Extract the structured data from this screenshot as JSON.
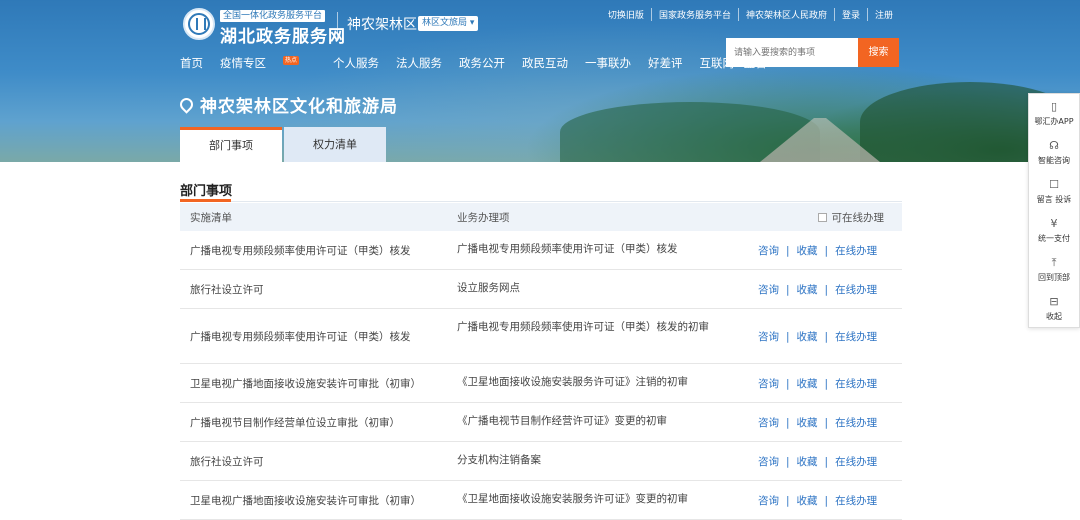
{
  "header": {
    "site_sub": "全国一体化政务服务平台",
    "site_name": "湖北政务服务网",
    "region": "神农架林区",
    "region_switch": "林区文旅局 ▾",
    "top_links": [
      "切换旧版",
      "国家政务服务平台",
      "神农架林区人民政府",
      "登录",
      "注册"
    ],
    "search_placeholder": "请输入要搜索的事项",
    "search_button": "搜索",
    "nav": [
      {
        "label": "首页"
      },
      {
        "label": "疫情专区",
        "badge": "热点"
      },
      {
        "label": "个人服务"
      },
      {
        "label": "法人服务"
      },
      {
        "label": "政务公开"
      },
      {
        "label": "政民互动"
      },
      {
        "label": "一事联办"
      },
      {
        "label": "好差评"
      },
      {
        "label": "互联网+监管"
      }
    ]
  },
  "department": {
    "title": "神农架林区文化和旅游局",
    "tabs": [
      "部门事项",
      "权力清单"
    ]
  },
  "section": {
    "title": "部门事项",
    "columns": {
      "implementation": "实施清单",
      "business": "业务办理项",
      "online": "可在线办理"
    },
    "rows": [
      {
        "impl": "广播电视专用频段频率使用许可证（甲类）核发",
        "item": "广播电视专用频段频率使用许可证（甲类）核发"
      },
      {
        "impl": "旅行社设立许可",
        "item": "设立服务网点"
      },
      {
        "impl": "广播电视专用频段频率使用许可证（甲类）核发",
        "item": "广播电视专用频段频率使用许可证（甲类）核发的初审"
      },
      {
        "impl": "卫星电视广播地面接收设施安装许可审批（初审）",
        "item": "《卫星地面接收设施安装服务许可证》注销的初审"
      },
      {
        "impl": "广播电视节目制作经营单位设立审批（初审）",
        "item": "《广播电视节目制作经营许可证》变更的初审"
      },
      {
        "impl": "旅行社设立许可",
        "item": "分支机构注销备案"
      },
      {
        "impl": "卫星电视广播地面接收设施安装许可审批（初审）",
        "item": "《卫星地面接收设施安装服务许可证》变更的初审"
      }
    ],
    "ops": {
      "consult": "咨询",
      "favorite": "收藏",
      "online": "在线办理",
      "sep": "|"
    }
  },
  "float_bar": [
    {
      "label": "鄂汇办APP",
      "icon": "phone-icon"
    },
    {
      "label": "智能咨询",
      "icon": "headset-icon"
    },
    {
      "label": "留言 投诉",
      "icon": "message-icon"
    },
    {
      "label": "统一支付",
      "icon": "yuan-icon"
    },
    {
      "label": "回到顶部",
      "icon": "arrow-up-icon"
    },
    {
      "label": "收起",
      "icon": "collapse-icon"
    }
  ],
  "colors": {
    "accent": "#f26522",
    "link": "#2e74c4",
    "banner": "#2f79b8"
  }
}
